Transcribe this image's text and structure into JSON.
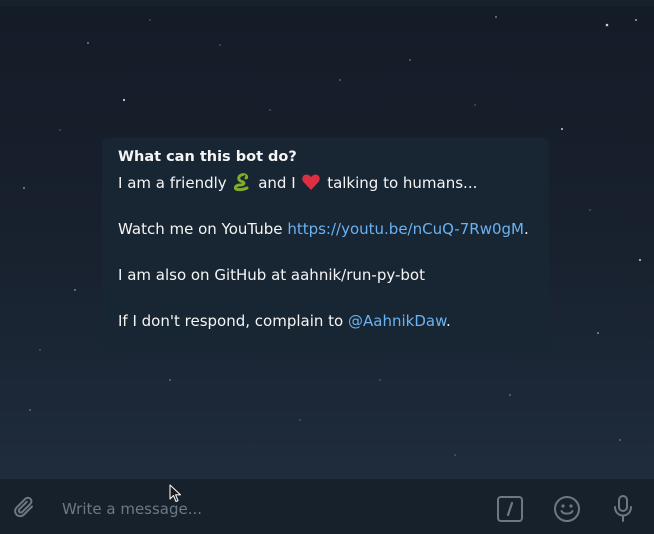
{
  "bot_intro": {
    "title": "What can this bot do?",
    "line1_prefix": "I am a friendly",
    "line1_mid": "and I",
    "line1_suffix": "talking to humans...",
    "line2_prefix": "Watch me on YouTube",
    "line2_link": "https://youtu.be/nCuQ-7Rw0gM",
    "line2_suffix": ".",
    "line3": "I am also on GitHub at aahnik/run-py-bot",
    "line4_prefix": "If I don't respond, complain to",
    "line4_mention": "@AahnikDaw",
    "line4_suffix": "."
  },
  "composer": {
    "placeholder": "Write a message..."
  },
  "icons": {
    "attach": "paperclip-icon",
    "commands": "slash-command-icon",
    "emoji": "smiley-icon",
    "voice": "microphone-icon",
    "snake": "snake-emoji",
    "heart": "heart-emoji"
  },
  "colors": {
    "background": "#17212b",
    "card": "#182533",
    "link": "#6ab2f2",
    "icon": "#6d7883"
  }
}
